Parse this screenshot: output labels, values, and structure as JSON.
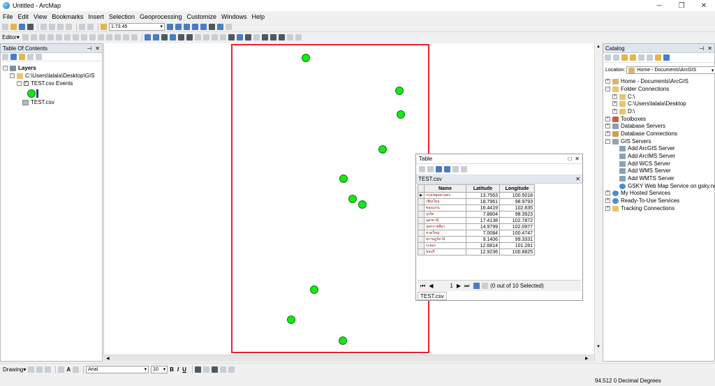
{
  "window": {
    "title": "Untitled - ArcMap",
    "minimize_glyph": "─",
    "maximize_glyph": "❐",
    "close_glyph": "✕"
  },
  "menu": [
    "File",
    "Edit",
    "View",
    "Bookmarks",
    "Insert",
    "Selection",
    "Geoprocessing",
    "Customize",
    "Windows",
    "Help"
  ],
  "toolbar": {
    "scale": "1:73.45",
    "editor_label": "Editor▾"
  },
  "toc": {
    "title": "Table Of Contents",
    "layers_label": "Layers",
    "folder_path": "C:\\Users\\lalala\\Desktop\\GIS",
    "events_layer": "TEST.csv Events",
    "table_item": "TEST.csv"
  },
  "catalog": {
    "title": "Catalog",
    "location_label": "Location:",
    "location_value": "Home - Documents\\ArcGIS",
    "items": [
      "Home - Documents\\ArcGIS",
      "Folder Connections",
      "C:\\",
      "C:\\Users\\lalala\\Desktop",
      "D:\\",
      "Toolboxes",
      "Database Servers",
      "Database Connections",
      "GIS Servers",
      "Add ArcGIS Server",
      "Add ArcIMS Server",
      "Add WCS Server",
      "Add WMS Server",
      "Add WMTS Server",
      "GSKY Web Map Service on gsky.nci",
      "My Hosted Services",
      "Ready-To-Use Services",
      "Tracking Connections"
    ]
  },
  "table_window": {
    "title": "Table",
    "tab": "TEST.csv",
    "columns": [
      "Name",
      "Latitude",
      "Longitude"
    ],
    "rows": [
      {
        "name": "กรุงเทพมหานคร",
        "lat": "13.7563",
        "lon": "100.5018"
      },
      {
        "name": "เชียงใหม่",
        "lat": "18.7961",
        "lon": "98.9793"
      },
      {
        "name": "ขอนแก่น",
        "lat": "16.4419",
        "lon": "102.835"
      },
      {
        "name": "ภูเก็ต",
        "lat": "7.8804",
        "lon": "98.3923"
      },
      {
        "name": "อุดรธานี",
        "lat": "17.4138",
        "lon": "102.7872"
      },
      {
        "name": "นครราชสีมา",
        "lat": "14.9799",
        "lon": "102.0977"
      },
      {
        "name": "หาดใหญ่",
        "lat": "7.0084",
        "lon": "100.4747"
      },
      {
        "name": "สุราษฎร์ธานี",
        "lat": "9.1406",
        "lon": "99.3331"
      },
      {
        "name": "ระยอง",
        "lat": "12.6814",
        "lon": "101.281"
      },
      {
        "name": "ชลบุรี",
        "lat": "12.9236",
        "lon": "100.8825"
      }
    ],
    "record_number": "1",
    "selection_status": "(0 out of 10 Selected)"
  },
  "drawing": {
    "label": "Drawing▾",
    "font": "Arial",
    "size": "10",
    "bold": "B",
    "italic": "I",
    "underline": "U"
  },
  "status": {
    "coordinates": "94.512 0 Decimal Degrees"
  },
  "colors": {
    "point_fill": "#19e619",
    "frame_border": "#e8202a",
    "panel_header": "#dfe6ee"
  }
}
